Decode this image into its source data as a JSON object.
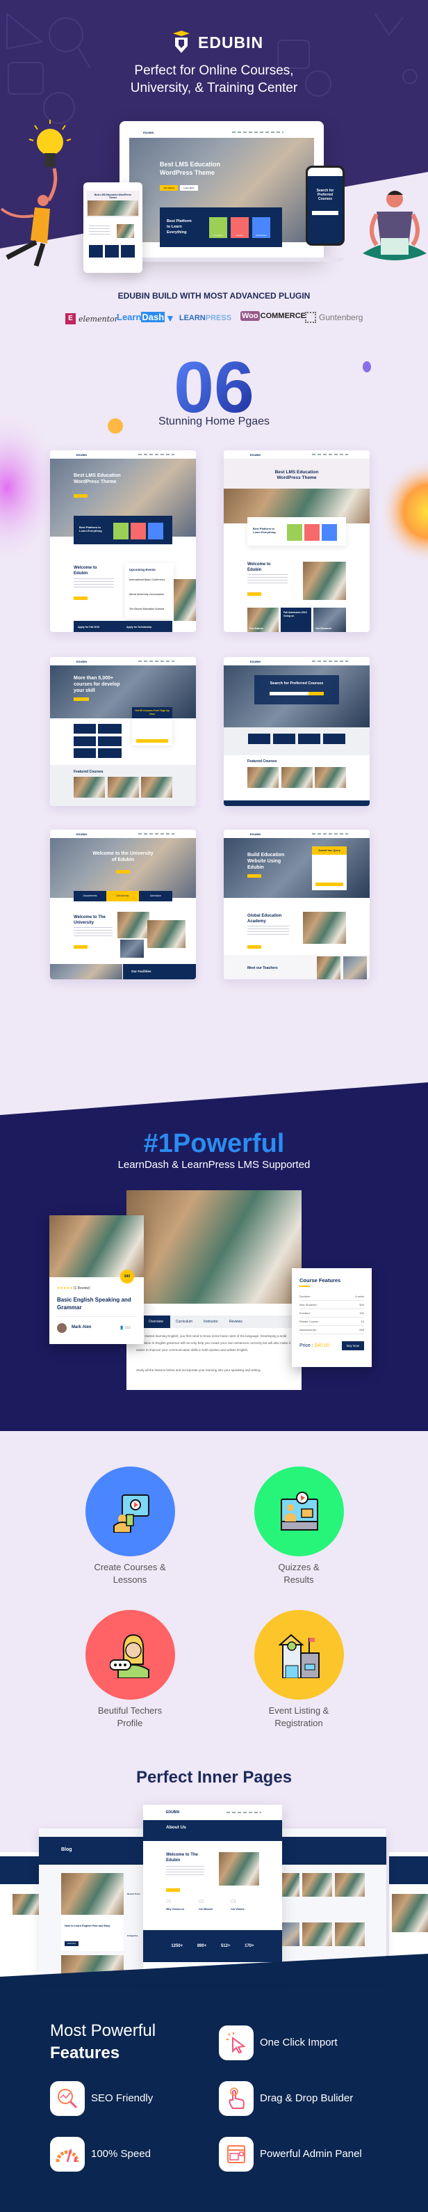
{
  "colors": {
    "hero_purple": "#372b6b",
    "light_bg": "#efe8f6",
    "deep_navy": "#1c1b5e",
    "footer_navy": "#0b2650",
    "accent_yellow": "#ffc600",
    "accent_blue": "#2b8cf0"
  },
  "hero": {
    "brand": "EDUBIN",
    "tagline_line1": "Perfect for Online Courses,",
    "tagline_line2": "University, & Training Center",
    "laptop": {
      "logo": "EDUBIN",
      "title_line1": "Best LMS Education",
      "title_line2": "WordPress Theme",
      "btn_primary": "Get Started",
      "btn_secondary": "Learn More",
      "platform_line1": "Best Platform",
      "platform_line2": "to Learn",
      "platform_line3": "Everything",
      "tiles": [
        "Programs",
        "Events",
        "Admissions"
      ]
    },
    "phone": {
      "title_line1": "Search for",
      "title_line2": "Preferred",
      "title_line3": "Courses"
    },
    "tablet": {
      "title": "Best LMS Education WordPress Theme"
    }
  },
  "plugins": {
    "heading": "EDUBIN BUILD WITH MOST ADVANCED PLUGIN",
    "items": [
      {
        "name": "elementor",
        "icon": "elementor-logo"
      },
      {
        "name_a": "Learn",
        "name_b": "Dash",
        "icon": "learndash-logo"
      },
      {
        "name_a": "LEARN",
        "name_b": "PRESS",
        "icon": "learnpress-logo"
      },
      {
        "name_a": "Woo",
        "name_b": "COMMERCE",
        "icon": "woocommerce-logo"
      },
      {
        "name": "Guntenberg",
        "icon": "gutenberg-logo"
      }
    ]
  },
  "homepages": {
    "count": "06",
    "subtitle": "Stunning Home Pgaes",
    "thumbs": [
      {
        "hero": "Best LMS Education WordPress Theme",
        "platform": "Best Platform to Learn Everything",
        "about": "Welcome to Edubin",
        "events": "Upcoming Events",
        "event_items": [
          "International Basic Conference",
          "World University Convocation",
          "The Eames Education Summit"
        ],
        "band_a": "Apply for Fall 2019",
        "band_b": "Apply for Scholarship"
      },
      {
        "hero": "Best LMS Education WordPress Theme",
        "platform": "Best Platform to Learn Everything",
        "about": "Welcome to Edubin",
        "card_a": "Our Awards",
        "card_b": "Fall Admission 2019 Going on",
        "card_c": "Our Research"
      },
      {
        "hero": "More than 5,000+ courses for develop your skill",
        "form_title": "Get 50 Courses Free! Sign Up Now",
        "section": "Featured Courses"
      },
      {
        "hero": "Search for Preferred Courses",
        "section": "Featured Courses"
      },
      {
        "hero": "Welcome to the University of Edubin",
        "tabs": [
          "Departments",
          "Scholarship",
          "Admission"
        ],
        "about": "Welcome to The University",
        "band": "Our Facilities"
      },
      {
        "hero": "Build Education Website Using Edubin",
        "form_title": "Submit Your Query",
        "about": "Global Education Academy",
        "section": "Meet our Teachers"
      }
    ]
  },
  "lms": {
    "title": "#1Powerful",
    "subtitle": "LearnDash & LearnPress LMS  Supported",
    "course_card": {
      "price_badge": "$40",
      "reviews": "(1 Review)",
      "rating": 5,
      "title": "Basic English Speaking and Grammar",
      "author": "Mark Alen",
      "students": "152"
    },
    "detail": {
      "tabs": [
        "Overview",
        "Curriculum",
        "Instructor",
        "Reviews"
      ],
      "para1": "...just started learning English, you first need to know some basic rules of the language. Developing a solid foundation in English grammar will not only help you create your own sentences correctly but will also make it easier to improve your communication skills in both spoken and written English.",
      "para2": "Study all the lessons below and incorporate your learning into your speaking and writing."
    },
    "features": {
      "title": "Course Features",
      "rows": [
        {
          "label": "Duration :",
          "value": "6 week"
        },
        {
          "label": "Max Students :",
          "value": "500"
        },
        {
          "label": "Enrolled :",
          "value": "152"
        },
        {
          "label": "Retake Course :",
          "value": "10"
        },
        {
          "label": "Assessments :",
          "value": "Self"
        }
      ],
      "price_label": "Price :",
      "price": "$40.00",
      "buy": "Buy Now"
    }
  },
  "lms_features": [
    {
      "label_line1": "Create Courses &",
      "label_line2": "Lessons",
      "color": "#4a86ff",
      "icon": "video-lesson-icon"
    },
    {
      "label_line1": "Quizzes &",
      "label_line2": "Results",
      "color": "#26f57a",
      "icon": "quiz-video-icon"
    },
    {
      "label_line1": "Beutiful Techers",
      "label_line2": "Profile",
      "color": "#ff6366",
      "icon": "teacher-profile-icon"
    },
    {
      "label_line1": "Event Listing &",
      "label_line2": "Registration",
      "color": "#fcc52a",
      "icon": "school-building-icon"
    }
  ],
  "inner": {
    "title": "Perfect Inner Pages",
    "about": {
      "page_title": "About Us",
      "heading": "Welcome to The Edubin",
      "cols": [
        {
          "num": "01",
          "label": "Why Choose us"
        },
        {
          "num": "02",
          "label": "Our Mission"
        },
        {
          "num": "03",
          "label": "Our Visions"
        }
      ],
      "stats": [
        "1250+",
        "890+",
        "512+",
        "170+"
      ]
    },
    "blog": {
      "page_title": "Blog",
      "post": "How to Learn English Fast and Easy",
      "recent": "Recent Posts",
      "categories": "Categories",
      "btn": "Read More"
    }
  },
  "features": {
    "title_light": "Most Powerful",
    "title_bold": "Features",
    "items": [
      {
        "label": "One Click Import",
        "icon": "cursor-click-icon"
      },
      {
        "label": "SEO Friendly",
        "icon": "seo-search-icon"
      },
      {
        "label": "Drag & Drop Bulider",
        "icon": "hand-pointer-icon"
      },
      {
        "label": "100% Speed",
        "icon": "speedometer-icon"
      },
      {
        "label": "Powerful Admin Panel",
        "icon": "admin-panel-icon"
      }
    ]
  }
}
